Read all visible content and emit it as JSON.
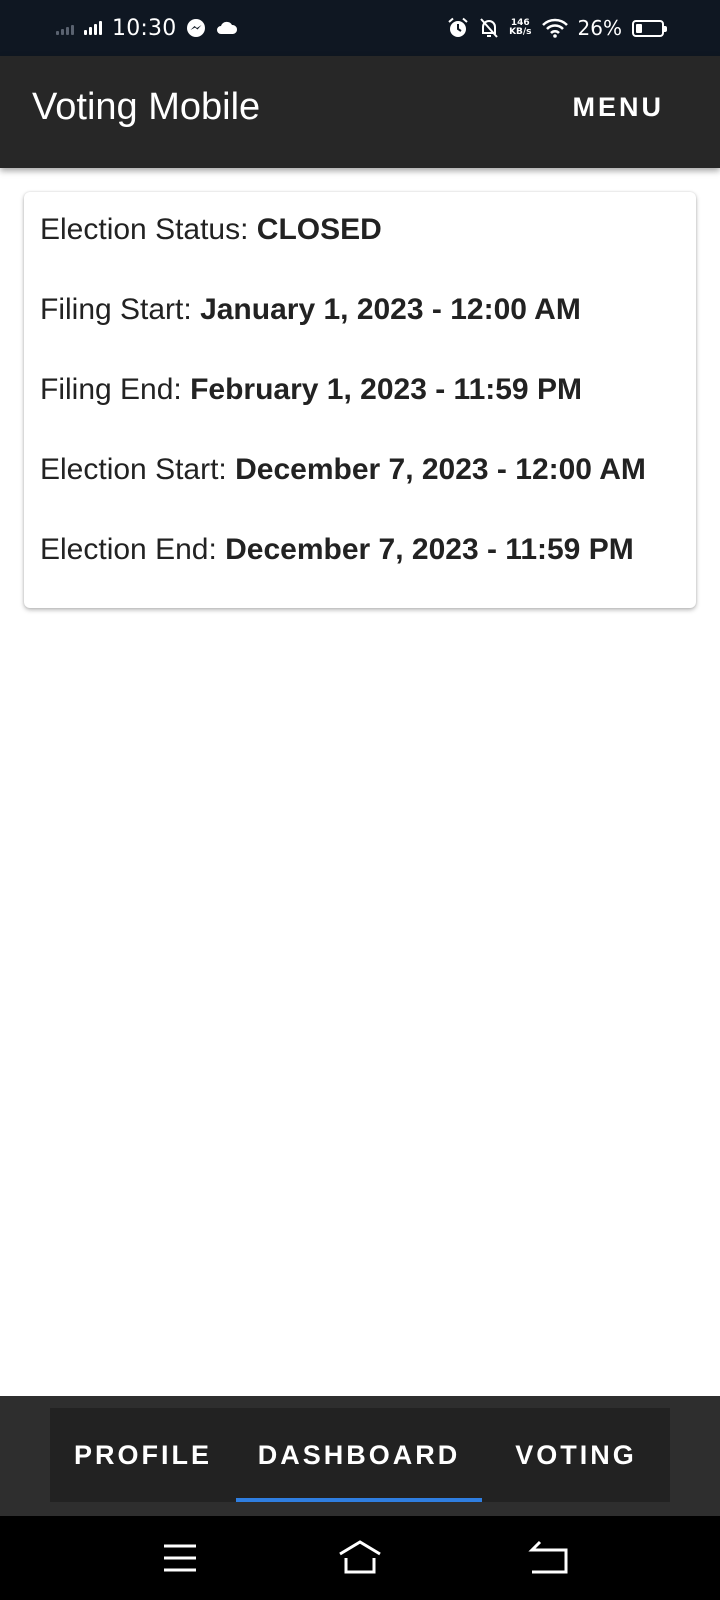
{
  "status_bar": {
    "time": "10:30",
    "net_speed_value": "146",
    "net_speed_unit": "KB/s",
    "battery_percent": "26%",
    "battery_level": 0.26,
    "icons": [
      "signal-icon",
      "messenger-icon",
      "cloud-icon",
      "alarm-icon",
      "bell-off-icon",
      "wifi-icon",
      "battery-icon"
    ]
  },
  "app_bar": {
    "title": "Voting Mobile",
    "menu_label": "MENU"
  },
  "election_info": {
    "status_label": "Election Status: ",
    "status_value": "CLOSED",
    "filing_start_label": "Filing Start: ",
    "filing_start_value": "January 1, 2023 - 12:00 AM",
    "filing_end_label": "Filing End: ",
    "filing_end_value": "February 1, 2023 - 11:59 PM",
    "election_start_label": "Election Start: ",
    "election_start_value": "December 7, 2023 - 12:00 AM",
    "election_end_label": "Election End: ",
    "election_end_value": "December 7, 2023 - 11:59 PM"
  },
  "bottom_nav": {
    "tabs": [
      {
        "label": "PROFILE",
        "active": false
      },
      {
        "label": "DASHBOARD",
        "active": true
      },
      {
        "label": "VOTING",
        "active": false
      }
    ],
    "accent_color": "#2f7ee0"
  },
  "system_nav": {
    "icons": [
      "menu-icon",
      "home-icon",
      "back-icon"
    ]
  }
}
